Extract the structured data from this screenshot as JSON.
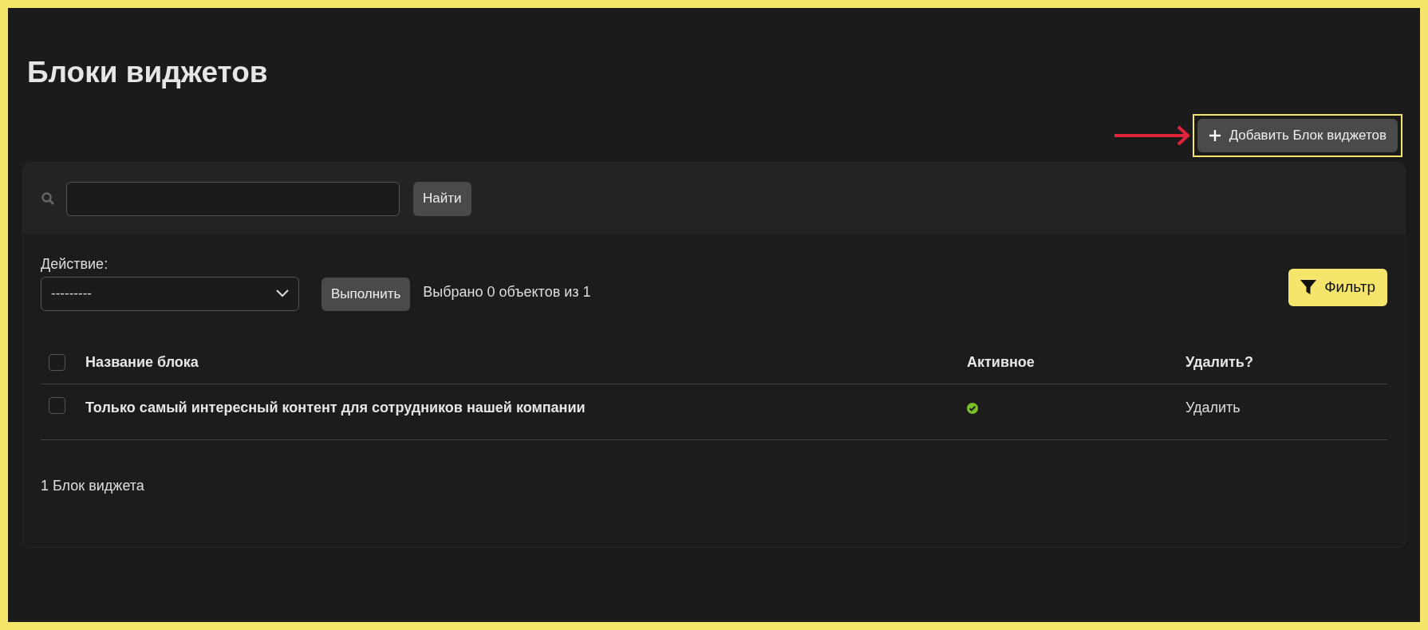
{
  "title": "Блоки виджетов",
  "add_button": {
    "label": "Добавить Блок виджетов",
    "highlighted": true
  },
  "search": {
    "button": "Найти"
  },
  "action": {
    "label": "Действие:",
    "value": "---------",
    "button": "Выполнить"
  },
  "selection_counter": "Выбрано 0 объектов из 1",
  "filter_button": "Фильтр",
  "table": {
    "select_all_checked": false,
    "columns": [
      "Название блока",
      "Активное",
      "Удалить?"
    ],
    "rows": [
      {
        "checked": false,
        "name": "Только самый интересный контент для сотрудников нашей компании",
        "active": true,
        "delete": "Удалить"
      }
    ]
  },
  "footer": "1 Блок виджета"
}
